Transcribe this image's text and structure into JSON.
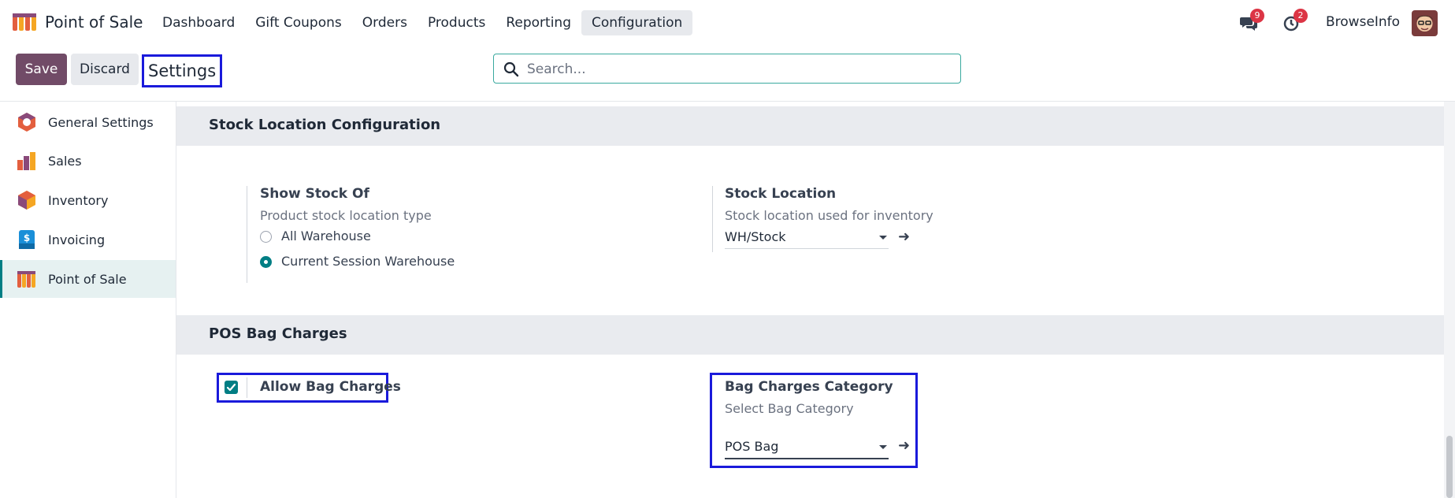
{
  "navbar": {
    "app_name": "Point of Sale",
    "menu": [
      "Dashboard",
      "Gift Coupons",
      "Orders",
      "Products",
      "Reporting",
      "Configuration"
    ],
    "active_menu": "Configuration",
    "messages_count": "9",
    "activities_count": "2",
    "user_name": "BrowseInfo"
  },
  "control": {
    "save_label": "Save",
    "discard_label": "Discard",
    "title": "Settings",
    "search_placeholder": "Search..."
  },
  "sidebar": {
    "items": [
      {
        "label": "General Settings",
        "icon": "general-settings-icon"
      },
      {
        "label": "Sales",
        "icon": "sales-icon"
      },
      {
        "label": "Inventory",
        "icon": "inventory-icon"
      },
      {
        "label": "Invoicing",
        "icon": "invoicing-icon"
      },
      {
        "label": "Point of Sale",
        "icon": "point-of-sale-icon"
      }
    ],
    "active": "Point of Sale"
  },
  "sections": {
    "stock": {
      "title": "Stock Location Configuration",
      "show_stock": {
        "title": "Show Stock Of",
        "desc": "Product stock location type",
        "options": [
          "All Warehouse",
          "Current Session Warehouse"
        ],
        "selected": "Current Session Warehouse"
      },
      "stock_location": {
        "title": "Stock Location",
        "desc": "Stock location used for inventory",
        "value": "WH/Stock"
      }
    },
    "bag": {
      "title": "POS Bag Charges",
      "allow": {
        "label": "Allow Bag Charges",
        "checked": true
      },
      "category": {
        "title": "Bag Charges Category",
        "desc": "Select Bag Category",
        "value": "POS Bag"
      }
    }
  },
  "colors": {
    "primary": "#714b67",
    "accent": "#017e84",
    "highlight": "#1a1adb",
    "badge": "#dc3545"
  }
}
